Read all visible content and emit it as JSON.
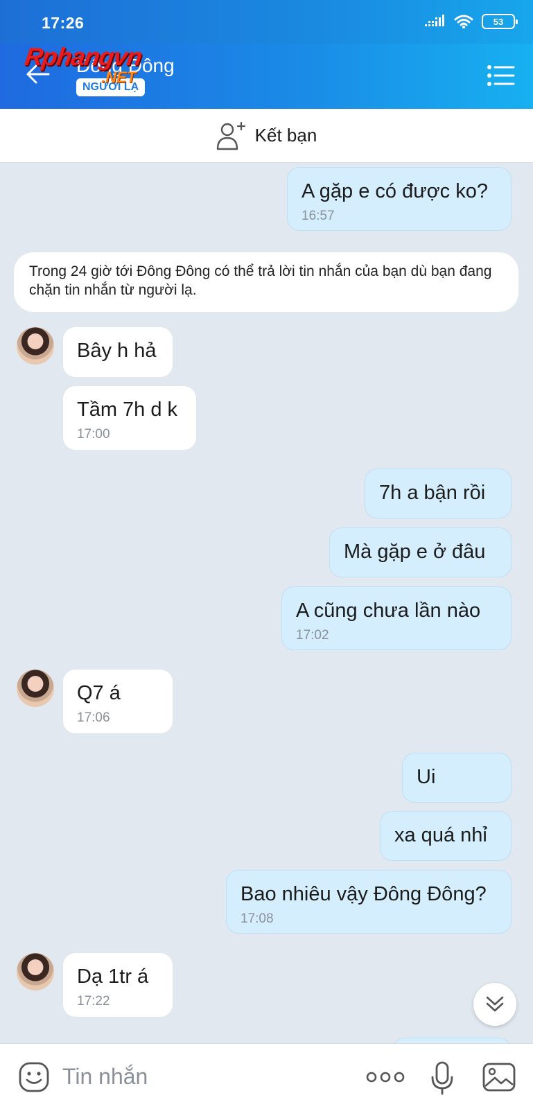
{
  "status_bar": {
    "time": "17:26",
    "battery": "53"
  },
  "header": {
    "contact_name": "Đông Đông",
    "badge": "NGƯỜI LẠ",
    "watermark": "Rphangvn",
    "watermark_sub": ".NET"
  },
  "add_friend": {
    "label": "Kết bạn"
  },
  "notice": {
    "text": "Trong 24 giờ tới Đông Đông có thể trả lời tin nhắn của bạn dù bạn đang chặn tin nhắn từ người lạ."
  },
  "messages": [
    {
      "sender": "me",
      "text": "A gặp e có được ko?",
      "time": "16:57"
    },
    {
      "sender": "them",
      "text": "Bây h hả",
      "time": ""
    },
    {
      "sender": "them",
      "text": "Tầm 7h d k",
      "time": "17:00"
    },
    {
      "sender": "me",
      "text": "7h a bận rồi",
      "time": ""
    },
    {
      "sender": "me",
      "text": "Mà gặp e ở đâu",
      "time": ""
    },
    {
      "sender": "me",
      "text": "A cũng chưa lần nào",
      "time": "17:02"
    },
    {
      "sender": "them",
      "text": "Q7 á",
      "time": "17:06"
    },
    {
      "sender": "me",
      "text": "Ui",
      "time": ""
    },
    {
      "sender": "me",
      "text": "xa quá nhỉ",
      "time": ""
    },
    {
      "sender": "me",
      "text": "Bao nhiêu vậy Đông Đông?",
      "time": "17:08"
    },
    {
      "sender": "them",
      "text": "Dạ 1tr á",
      "time": "17:22"
    }
  ],
  "input": {
    "placeholder": "Tin nhắn"
  },
  "colors": {
    "header_start": "#1f6ae0",
    "header_end": "#17b0f0",
    "chat_bg": "#e2e8f0",
    "my_bubble": "#d4eefd",
    "their_bubble": "#ffffff"
  }
}
